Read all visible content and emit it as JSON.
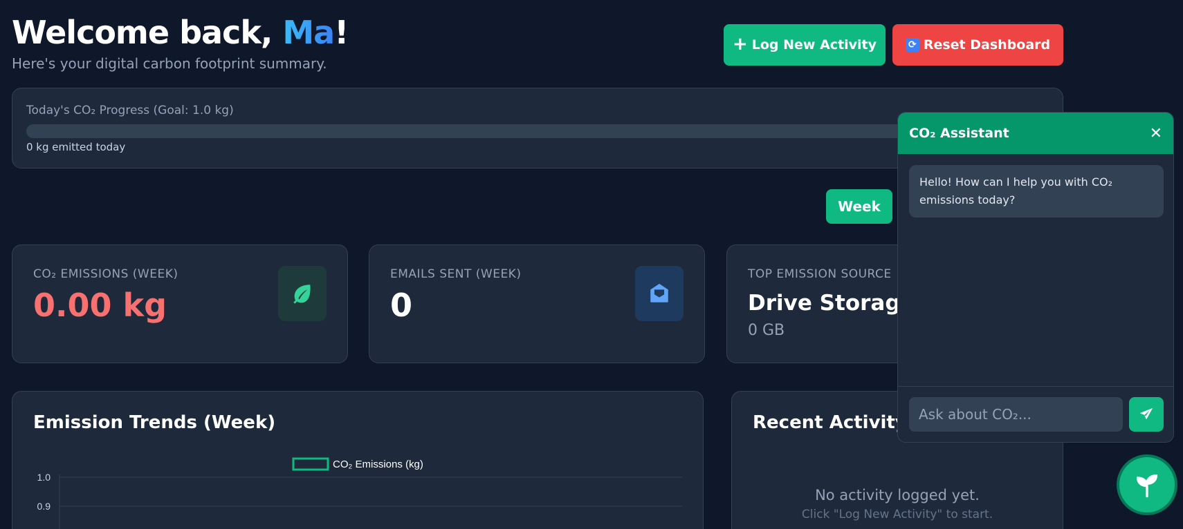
{
  "header": {
    "welcome_prefix": "Welcome back, ",
    "user_name": "Ma",
    "welcome_suffix": "!",
    "subtitle": "Here's your digital carbon footprint summary.",
    "log_button": "Log New Activity",
    "reset_button": "Reset Dashboard"
  },
  "progress": {
    "label": "Today's CO₂ Progress (Goal: 1.0 kg)",
    "emitted_text": "0 kg emitted today",
    "fraction": 0
  },
  "period_button": "Week",
  "stats": [
    {
      "label": "CO₂ EMISSIONS (WEEK)",
      "value": "0.00 kg",
      "icon": "leaf-icon"
    },
    {
      "label": "EMAILS SENT (WEEK)",
      "value": "0",
      "icon": "envelope-open-icon"
    },
    {
      "label": "TOP EMISSION SOURCE",
      "value": "Drive Storage",
      "extra": "0 GB"
    }
  ],
  "trend": {
    "title": "Emission Trends (Week)"
  },
  "chart_data": {
    "type": "line",
    "series": [
      {
        "name": "CO₂ Emissions (kg)",
        "values": []
      }
    ],
    "y_ticks": [
      "1.0",
      "0.9"
    ],
    "legend_position": "top-center",
    "grid": true
  },
  "recent": {
    "title": "Recent Activity",
    "empty_main": "No activity logged yet.",
    "empty_sub": "Click \"Log New Activity\" to start."
  },
  "chat": {
    "title": "CO₂ Assistant",
    "close": "✕",
    "greeting": "Hello! How can I help you with CO₂ emissions today?",
    "placeholder": "Ask about CO₂..."
  },
  "colors": {
    "accent": "#10b981",
    "danger": "#ef4444",
    "background": "#0f172a",
    "card": "#1e293b"
  }
}
